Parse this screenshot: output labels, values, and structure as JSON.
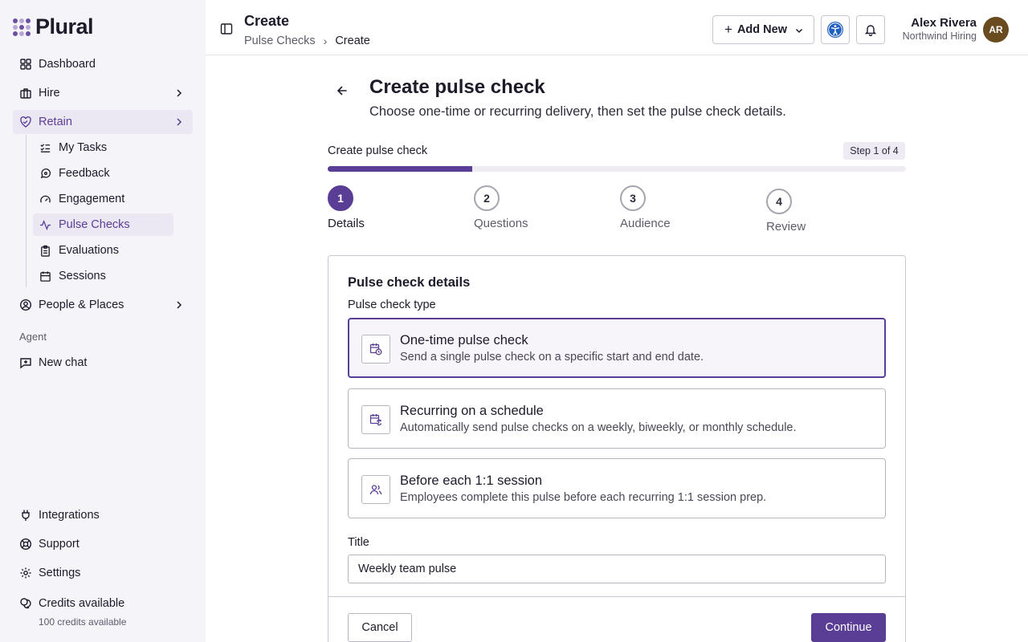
{
  "app": {
    "name": "Plural"
  },
  "sidebar": {
    "items": [
      {
        "label": "Dashboard",
        "icon": "grid-icon"
      },
      {
        "label": "Hire",
        "icon": "briefcase-icon"
      },
      {
        "label": "Retain",
        "icon": "heart-handshake-icon"
      },
      {
        "label": "People & Places",
        "icon": "user-circle-icon"
      }
    ],
    "retain_sub": [
      {
        "label": "My Tasks",
        "icon": "checklist-icon"
      },
      {
        "label": "Feedback",
        "icon": "message-circle-icon"
      },
      {
        "label": "Engagement",
        "icon": "gauge-icon"
      },
      {
        "label": "Pulse Checks",
        "icon": "activity-icon"
      },
      {
        "label": "Evaluations",
        "icon": "clipboard-icon"
      },
      {
        "label": "Sessions",
        "icon": "calendar-icon"
      }
    ],
    "agent_section": "Agent",
    "new_chat": "New chat",
    "bottom": [
      {
        "label": "Integrations",
        "icon": "plug-icon"
      },
      {
        "label": "Support",
        "icon": "lifebuoy-icon"
      },
      {
        "label": "Settings",
        "icon": "gear-icon"
      },
      {
        "label": "Credits available",
        "icon": "coins-icon"
      }
    ],
    "credits_sub": "100 credits available"
  },
  "header": {
    "title": "Create",
    "breadcrumb": [
      "Pulse Checks",
      "Create"
    ],
    "add_new": "Add New",
    "user_name": "Alex Rivera",
    "user_org": "Northwind Hiring",
    "user_initials": "AR"
  },
  "main": {
    "title": "Create pulse check",
    "subtitle": "Choose one-time or recurring delivery, then set the pulse check details.",
    "stepper_label": "Create pulse check",
    "step_badge": "Step 1 of 4",
    "progress": 0.25,
    "steps": [
      {
        "num": "1",
        "label": "Details"
      },
      {
        "num": "2",
        "label": "Questions"
      },
      {
        "num": "3",
        "label": "Audience"
      },
      {
        "num": "4",
        "label": "Review"
      }
    ],
    "card_title": "Pulse check details",
    "type_label": "Pulse check type",
    "options": [
      {
        "title": "One-time pulse check",
        "desc": "Send a single pulse check on a specific start and end date.",
        "icon": "calendar-clock-icon"
      },
      {
        "title": "Recurring on a schedule",
        "desc": "Automatically send pulse checks on a weekly, biweekly, or monthly schedule.",
        "icon": "calendar-repeat-icon"
      },
      {
        "title": "Before each 1:1 session",
        "desc": "Employees complete this pulse before each recurring 1:1 session prep.",
        "icon": "users-icon"
      }
    ],
    "title_label": "Title",
    "title_value": "Weekly team pulse",
    "cancel": "Cancel",
    "continue": "Continue"
  },
  "colors": {
    "accent": "#5a3e96",
    "sidebar_bg": "#f5f4f8",
    "active_bg": "#ebe7f3"
  }
}
